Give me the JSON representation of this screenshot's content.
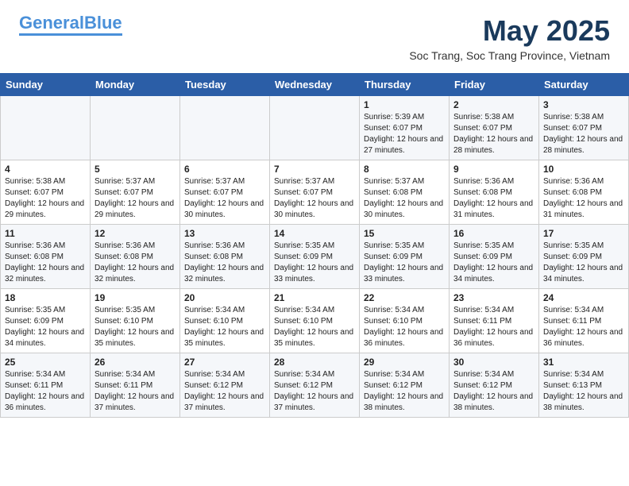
{
  "header": {
    "logo_general": "General",
    "logo_blue": "Blue",
    "title": "May 2025",
    "subtitle": "Soc Trang, Soc Trang Province, Vietnam"
  },
  "weekdays": [
    "Sunday",
    "Monday",
    "Tuesday",
    "Wednesday",
    "Thursday",
    "Friday",
    "Saturday"
  ],
  "weeks": [
    [
      {
        "num": "",
        "info": ""
      },
      {
        "num": "",
        "info": ""
      },
      {
        "num": "",
        "info": ""
      },
      {
        "num": "",
        "info": ""
      },
      {
        "num": "1",
        "info": "Sunrise: 5:39 AM\nSunset: 6:07 PM\nDaylight: 12 hours and 27 minutes."
      },
      {
        "num": "2",
        "info": "Sunrise: 5:38 AM\nSunset: 6:07 PM\nDaylight: 12 hours and 28 minutes."
      },
      {
        "num": "3",
        "info": "Sunrise: 5:38 AM\nSunset: 6:07 PM\nDaylight: 12 hours and 28 minutes."
      }
    ],
    [
      {
        "num": "4",
        "info": "Sunrise: 5:38 AM\nSunset: 6:07 PM\nDaylight: 12 hours and 29 minutes."
      },
      {
        "num": "5",
        "info": "Sunrise: 5:37 AM\nSunset: 6:07 PM\nDaylight: 12 hours and 29 minutes."
      },
      {
        "num": "6",
        "info": "Sunrise: 5:37 AM\nSunset: 6:07 PM\nDaylight: 12 hours and 30 minutes."
      },
      {
        "num": "7",
        "info": "Sunrise: 5:37 AM\nSunset: 6:07 PM\nDaylight: 12 hours and 30 minutes."
      },
      {
        "num": "8",
        "info": "Sunrise: 5:37 AM\nSunset: 6:08 PM\nDaylight: 12 hours and 30 minutes."
      },
      {
        "num": "9",
        "info": "Sunrise: 5:36 AM\nSunset: 6:08 PM\nDaylight: 12 hours and 31 minutes."
      },
      {
        "num": "10",
        "info": "Sunrise: 5:36 AM\nSunset: 6:08 PM\nDaylight: 12 hours and 31 minutes."
      }
    ],
    [
      {
        "num": "11",
        "info": "Sunrise: 5:36 AM\nSunset: 6:08 PM\nDaylight: 12 hours and 32 minutes."
      },
      {
        "num": "12",
        "info": "Sunrise: 5:36 AM\nSunset: 6:08 PM\nDaylight: 12 hours and 32 minutes."
      },
      {
        "num": "13",
        "info": "Sunrise: 5:36 AM\nSunset: 6:08 PM\nDaylight: 12 hours and 32 minutes."
      },
      {
        "num": "14",
        "info": "Sunrise: 5:35 AM\nSunset: 6:09 PM\nDaylight: 12 hours and 33 minutes."
      },
      {
        "num": "15",
        "info": "Sunrise: 5:35 AM\nSunset: 6:09 PM\nDaylight: 12 hours and 33 minutes."
      },
      {
        "num": "16",
        "info": "Sunrise: 5:35 AM\nSunset: 6:09 PM\nDaylight: 12 hours and 34 minutes."
      },
      {
        "num": "17",
        "info": "Sunrise: 5:35 AM\nSunset: 6:09 PM\nDaylight: 12 hours and 34 minutes."
      }
    ],
    [
      {
        "num": "18",
        "info": "Sunrise: 5:35 AM\nSunset: 6:09 PM\nDaylight: 12 hours and 34 minutes."
      },
      {
        "num": "19",
        "info": "Sunrise: 5:35 AM\nSunset: 6:10 PM\nDaylight: 12 hours and 35 minutes."
      },
      {
        "num": "20",
        "info": "Sunrise: 5:34 AM\nSunset: 6:10 PM\nDaylight: 12 hours and 35 minutes."
      },
      {
        "num": "21",
        "info": "Sunrise: 5:34 AM\nSunset: 6:10 PM\nDaylight: 12 hours and 35 minutes."
      },
      {
        "num": "22",
        "info": "Sunrise: 5:34 AM\nSunset: 6:10 PM\nDaylight: 12 hours and 36 minutes."
      },
      {
        "num": "23",
        "info": "Sunrise: 5:34 AM\nSunset: 6:11 PM\nDaylight: 12 hours and 36 minutes."
      },
      {
        "num": "24",
        "info": "Sunrise: 5:34 AM\nSunset: 6:11 PM\nDaylight: 12 hours and 36 minutes."
      }
    ],
    [
      {
        "num": "25",
        "info": "Sunrise: 5:34 AM\nSunset: 6:11 PM\nDaylight: 12 hours and 36 minutes."
      },
      {
        "num": "26",
        "info": "Sunrise: 5:34 AM\nSunset: 6:11 PM\nDaylight: 12 hours and 37 minutes."
      },
      {
        "num": "27",
        "info": "Sunrise: 5:34 AM\nSunset: 6:12 PM\nDaylight: 12 hours and 37 minutes."
      },
      {
        "num": "28",
        "info": "Sunrise: 5:34 AM\nSunset: 6:12 PM\nDaylight: 12 hours and 37 minutes."
      },
      {
        "num": "29",
        "info": "Sunrise: 5:34 AM\nSunset: 6:12 PM\nDaylight: 12 hours and 38 minutes."
      },
      {
        "num": "30",
        "info": "Sunrise: 5:34 AM\nSunset: 6:12 PM\nDaylight: 12 hours and 38 minutes."
      },
      {
        "num": "31",
        "info": "Sunrise: 5:34 AM\nSunset: 6:13 PM\nDaylight: 12 hours and 38 minutes."
      }
    ]
  ]
}
